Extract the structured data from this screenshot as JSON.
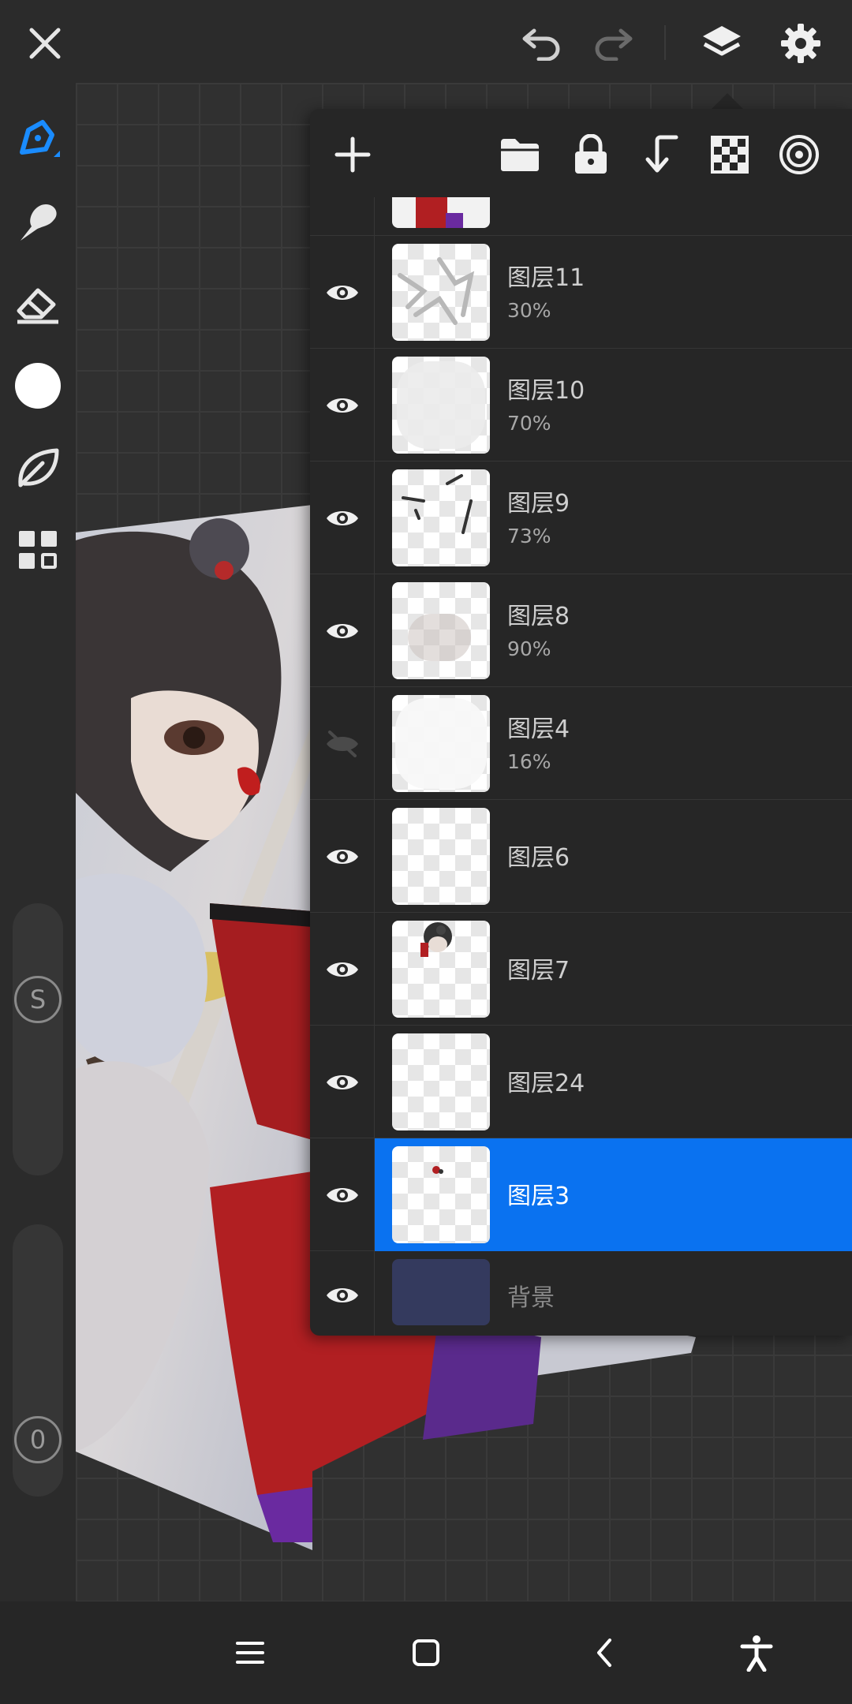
{
  "app": {
    "accent_color": "#0a72f0",
    "background_color": "#2b2b2b"
  },
  "topbar": {
    "close_icon": "close-icon",
    "undo_icon": "undo-icon",
    "redo_icon": "redo-icon",
    "layers_icon": "layers-icon",
    "settings_icon": "gear-icon"
  },
  "tools": [
    {
      "name": "pen-tool",
      "icon": "pen-icon",
      "active": true
    },
    {
      "name": "smudge-tool",
      "icon": "smudge-brush-icon"
    },
    {
      "name": "eraser-tool",
      "icon": "eraser-icon"
    },
    {
      "name": "color-picker",
      "icon": "color-circle-icon",
      "color": "#ffffff"
    },
    {
      "name": "shape-tool",
      "icon": "leaf-icon"
    },
    {
      "name": "more-tools",
      "icon": "grid-icon"
    }
  ],
  "sliders": {
    "size_label": "S",
    "opacity_label": "0"
  },
  "layers_panel": {
    "header_icons": [
      "add-icon",
      "folder-icon",
      "lock-icon",
      "merge-down-icon",
      "checker-icon",
      "target-icon"
    ],
    "layers": [
      {
        "name": "图层11",
        "opacity": "30%",
        "visible": true
      },
      {
        "name": "图层10",
        "opacity": "70%",
        "visible": true
      },
      {
        "name": "图层9",
        "opacity": "73%",
        "visible": true
      },
      {
        "name": "图层8",
        "opacity": "90%",
        "visible": true
      },
      {
        "name": "图层4",
        "opacity": "16%",
        "visible": false
      },
      {
        "name": "图层6",
        "opacity": "",
        "visible": true
      },
      {
        "name": "图层7",
        "opacity": "",
        "visible": true
      },
      {
        "name": "图层24",
        "opacity": "",
        "visible": true
      },
      {
        "name": "图层3",
        "opacity": "",
        "visible": true,
        "selected": true
      },
      {
        "name": "背景",
        "opacity": "",
        "visible": true,
        "background_color": "#343a5e"
      }
    ]
  },
  "navbar": {
    "icons": [
      "menu-icon",
      "home-icon",
      "back-icon",
      "accessibility-icon"
    ]
  }
}
